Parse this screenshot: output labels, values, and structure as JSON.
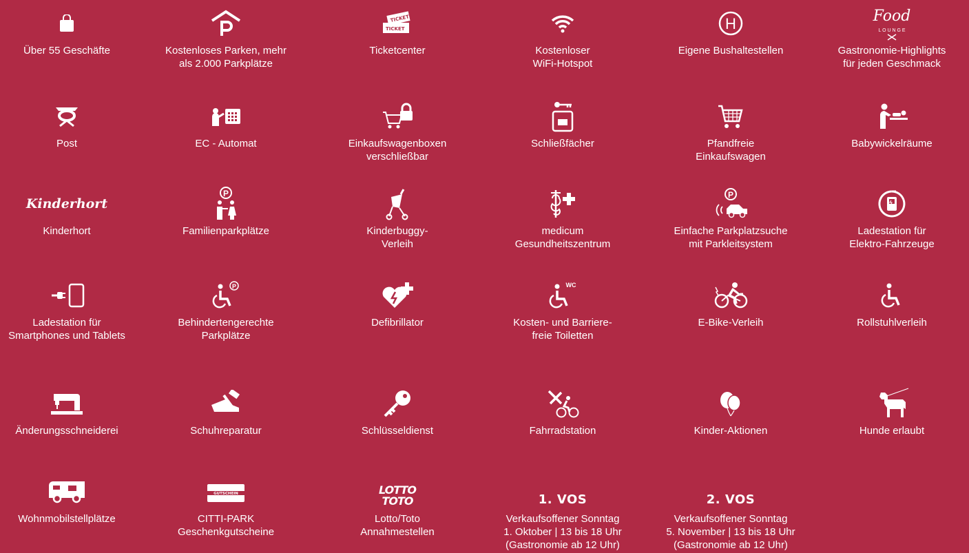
{
  "colors": {
    "background": "#b02a45",
    "foreground": "#ffffff"
  },
  "items": [
    {
      "icon": "shopping-bag-icon",
      "label": "Über 55 Geschäfte"
    },
    {
      "icon": "parking-icon",
      "label": "Kostenloses Parken, mehr\nals 2.000 Parkplätze"
    },
    {
      "icon": "ticket-icon",
      "label": "Ticketcenter",
      "icon_text_1": "TICKET",
      "icon_text_2": "TICKET"
    },
    {
      "icon": "wifi-icon",
      "label": "Kostenloser\nWiFi-Hotspot"
    },
    {
      "icon": "bus-stop-icon",
      "label": "Eigene Bushaltestellen",
      "icon_text": "H"
    },
    {
      "icon": "food-lounge-logo",
      "label": "Gastronomie-Highlights\nfür jeden Geschmack",
      "icon_text_1": "Food",
      "icon_text_2": "L O U N G E"
    },
    {
      "icon": "post-horn-icon",
      "label": "Post"
    },
    {
      "icon": "atm-icon",
      "label": "EC - Automat"
    },
    {
      "icon": "cart-lock-icon",
      "label": "Einkaufswagenboxen\nverschließbar"
    },
    {
      "icon": "locker-icon",
      "label": "Schließfächer"
    },
    {
      "icon": "shopping-cart-icon",
      "label": "Pfandfreie\nEinkaufswagen"
    },
    {
      "icon": "baby-changing-icon",
      "label": "Babywickelräume"
    },
    {
      "icon": "kinderhort-logo",
      "label": "Kinderhort",
      "icon_text": "Kinderhort"
    },
    {
      "icon": "family-parking-icon",
      "label": "Familienparkplätze",
      "icon_text": "P"
    },
    {
      "icon": "stroller-icon",
      "label": "Kinderbuggy-\nVerleih"
    },
    {
      "icon": "medical-icon",
      "label": "medicum\nGesundheitszentrum"
    },
    {
      "icon": "parking-guidance-icon",
      "label": "Einfache Parkplatzsuche\nmit Parkleitsystem",
      "icon_text": "P"
    },
    {
      "icon": "ev-charging-icon",
      "label": "Ladestation für\nElektro-Fahrzeuge"
    },
    {
      "icon": "phone-charging-icon",
      "label": "Ladestation für\nSmartphones und Tablets"
    },
    {
      "icon": "disabled-parking-icon",
      "label": "Behindertengerechte\nParkplätze",
      "icon_text": "P"
    },
    {
      "icon": "defibrillator-icon",
      "label": "Defibrillator"
    },
    {
      "icon": "accessible-toilet-icon",
      "label": "Kosten- und Barriere-\nfreie Toiletten",
      "icon_text": "WC"
    },
    {
      "icon": "ebike-icon",
      "label": "E-Bike-Verleih"
    },
    {
      "icon": "wheelchair-icon",
      "label": "Rollstuhlverleih"
    },
    {
      "icon": "sewing-machine-icon",
      "label": "Änderungsschneiderei"
    },
    {
      "icon": "shoe-repair-icon",
      "label": "Schuhreparatur"
    },
    {
      "icon": "key-icon",
      "label": "Schlüsseldienst"
    },
    {
      "icon": "bike-station-icon",
      "label": "Fahrradstation"
    },
    {
      "icon": "balloons-icon",
      "label": "Kinder-Aktionen"
    },
    {
      "icon": "dog-icon",
      "label": "Hunde erlaubt"
    },
    {
      "icon": "camper-icon",
      "label": "Wohnmobilstellplätze"
    },
    {
      "icon": "gift-card-icon",
      "label": "CITTI-PARK\nGeschenkgutscheine",
      "icon_text": "GUTSCHEIN"
    },
    {
      "icon": "lotto-toto-logo",
      "label": "Lotto/Toto\nAnnahmestellen",
      "icon_text_1": "LOTTO",
      "icon_text_2": "TOTO"
    },
    {
      "title": "1. VOS",
      "label": "Verkaufsoffener Sonntag\n1. Oktober | 13 bis 18 Uhr\n(Gastronomie ab 12 Uhr)"
    },
    {
      "title": "2. VOS",
      "label": "Verkaufsoffener Sonntag\n5. November | 13 bis 18 Uhr\n(Gastronomie ab 12 Uhr)"
    }
  ]
}
